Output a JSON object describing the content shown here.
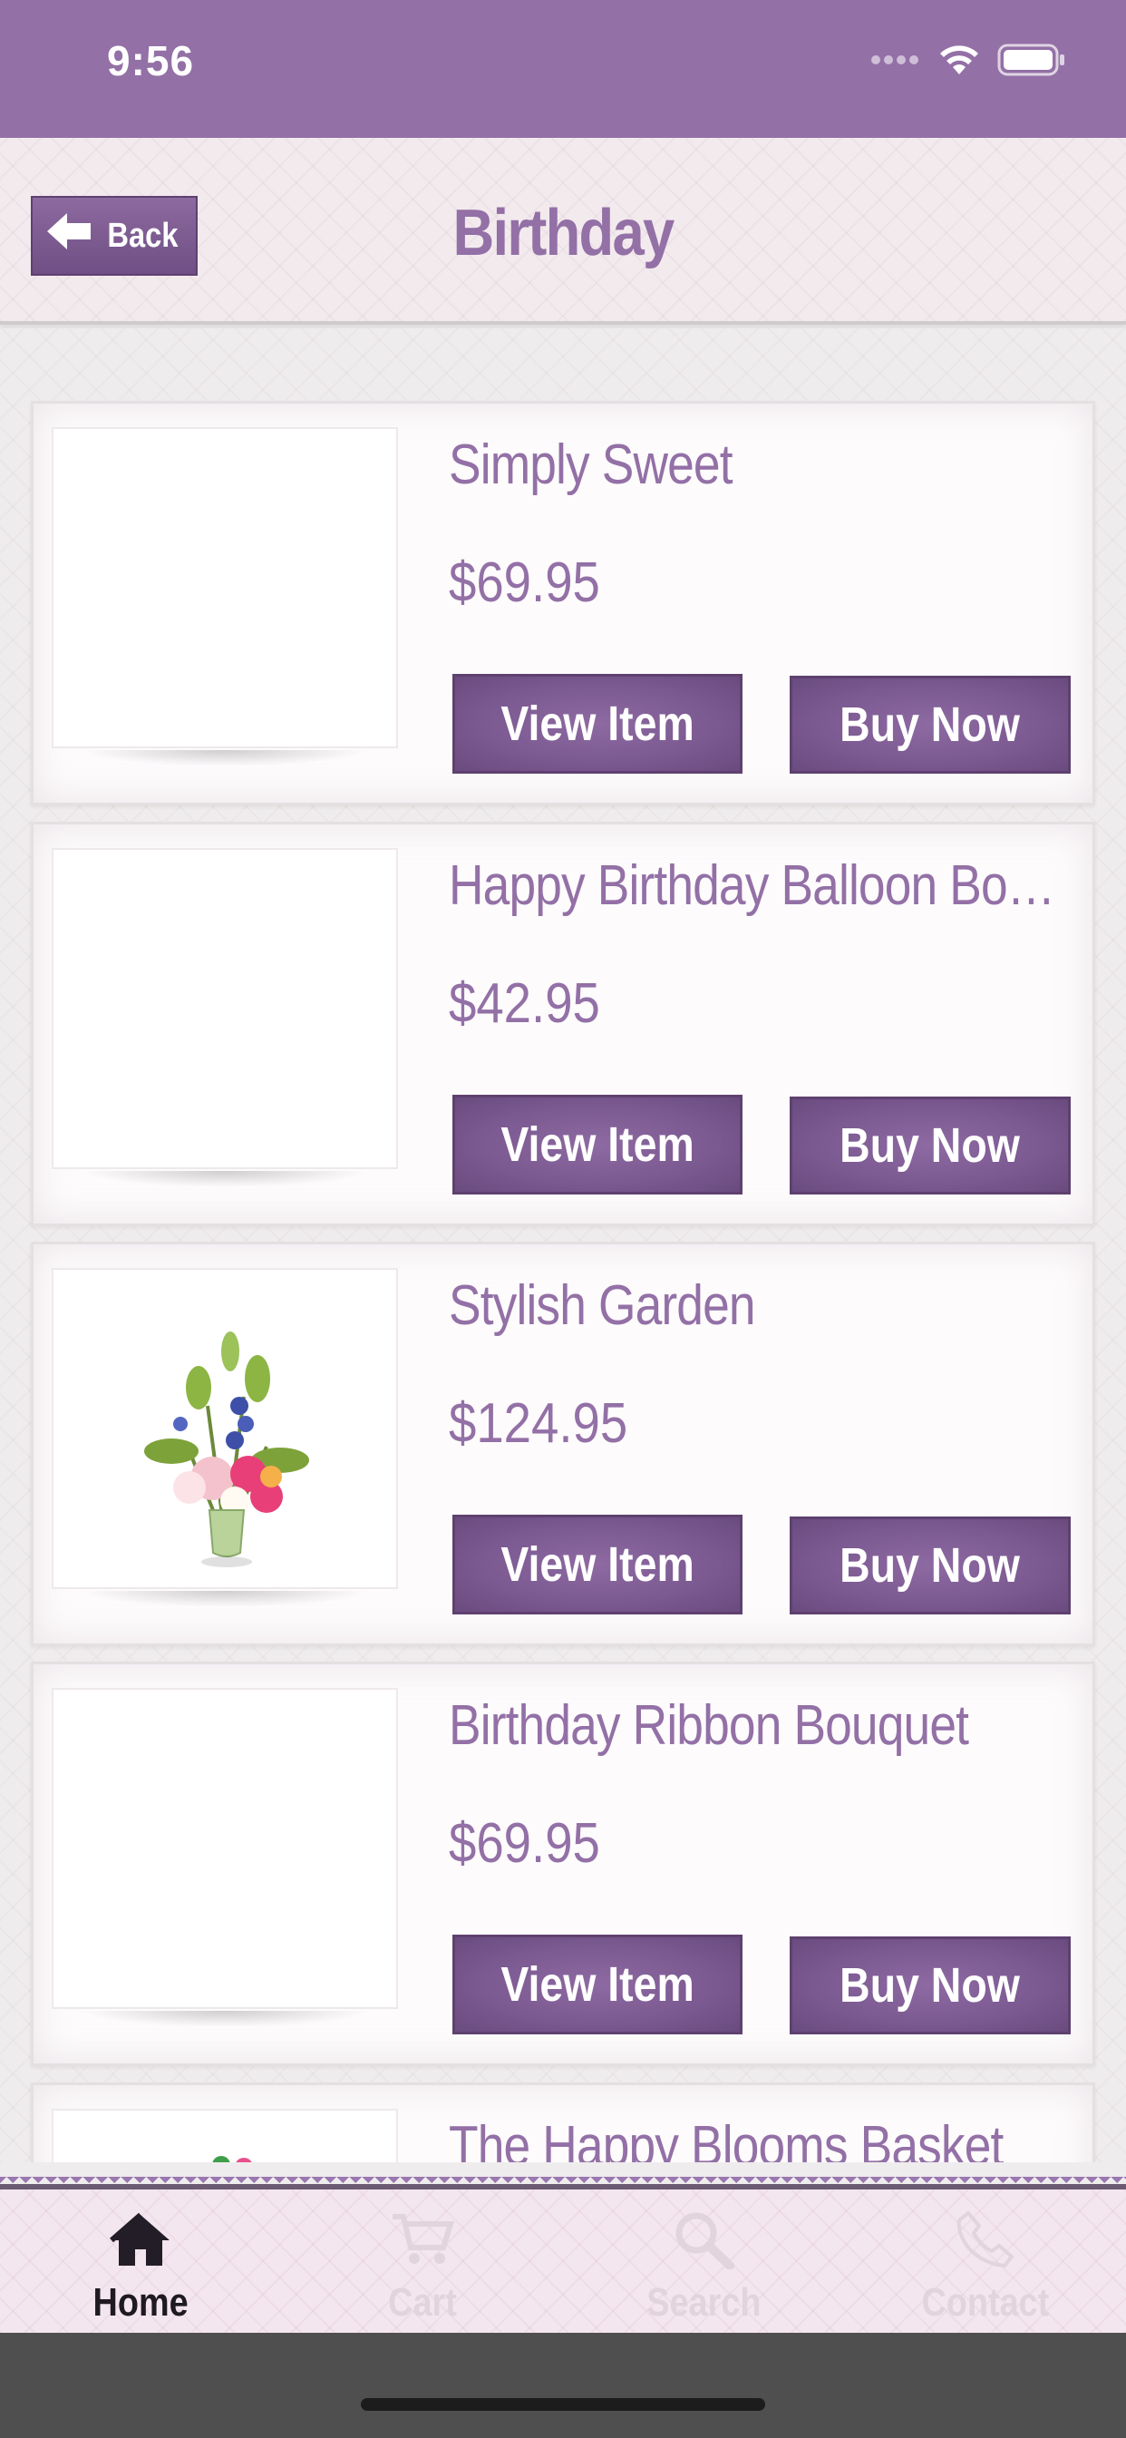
{
  "status_bar": {
    "time": "9:56",
    "background": "#9370a6",
    "icons": [
      "cellular-signal-icon",
      "wifi-icon",
      "battery-icon"
    ]
  },
  "header": {
    "back_label": "Back",
    "title": "Birthday",
    "accent": "#9370a6"
  },
  "products": [
    {
      "name": "Simply Sweet",
      "price": "$69.95",
      "view_label": "View Item",
      "buy_label": "Buy Now",
      "has_image": false
    },
    {
      "name": "Happy Birthday Balloon Bo…",
      "price": "$42.95",
      "view_label": "View Item",
      "buy_label": "Buy Now",
      "has_image": false
    },
    {
      "name": "Stylish Garden",
      "price": "$124.95",
      "view_label": "View Item",
      "buy_label": "Buy Now",
      "has_image": true
    },
    {
      "name": "Birthday Ribbon Bouquet",
      "price": "$69.95",
      "view_label": "View Item",
      "buy_label": "Buy Now",
      "has_image": false
    },
    {
      "name": "The Happy Blooms Basket",
      "price": "",
      "view_label": "",
      "buy_label": "",
      "has_image": true
    }
  ],
  "tabs": [
    {
      "label": "Home",
      "icon": "home-icon",
      "active": true
    },
    {
      "label": "Cart",
      "icon": "cart-icon",
      "active": false
    },
    {
      "label": "Search",
      "icon": "search-icon",
      "active": false
    },
    {
      "label": "Contact",
      "icon": "phone-icon",
      "active": false
    }
  ],
  "colors": {
    "button_purple": "#7a5890",
    "text_purple": "#9370a6",
    "tab_active": "#1f1a22",
    "tab_inactive": "#e2d4dd"
  }
}
